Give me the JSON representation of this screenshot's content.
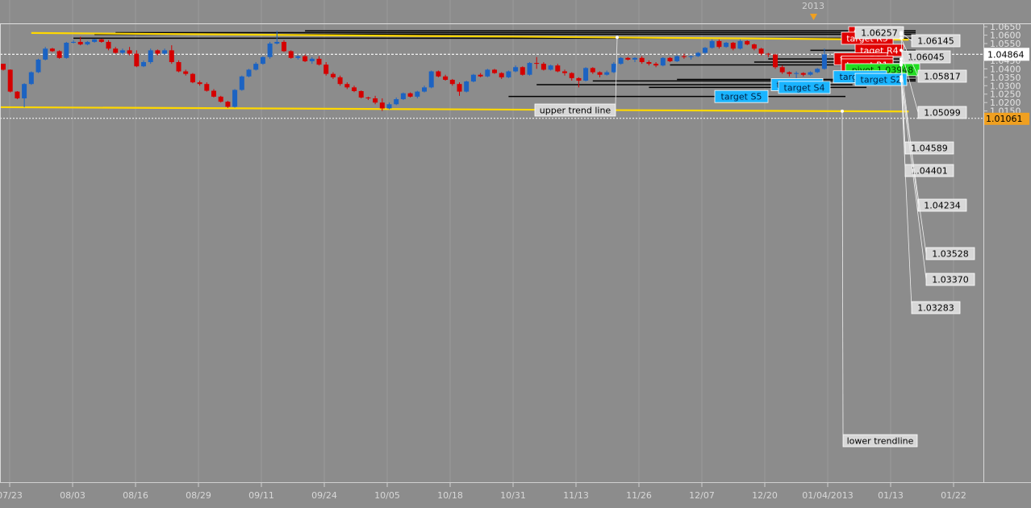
{
  "chart_data": {
    "type": "candlestick",
    "title": "",
    "xlabel": "",
    "ylabel": "",
    "ylim": [
      1.0106,
      1.0665
    ],
    "x_ticks": [
      "07/23",
      "08/03",
      "08/16",
      "08/29",
      "09/11",
      "09/24",
      "10/05",
      "10/18",
      "10/31",
      "11/13",
      "11/26",
      "12/07",
      "12/20",
      "01/04/2013",
      "01/13",
      "01/22"
    ],
    "y_ticks": [
      "1.0650",
      "1.0600",
      "1.0550",
      "1.0500",
      "1.0450",
      "1.0400",
      "1.0350",
      "1.0300",
      "1.0250",
      "1.0200",
      "1.0150"
    ],
    "year_marker": "2013",
    "current_price": "1.04864",
    "bottom_price": "1.01061",
    "colors": {
      "up": "#1c63c2",
      "down": "#d40000",
      "background": "#8c8c8c",
      "trendline": "#ffd800"
    },
    "candles": [
      [
        1.043,
        1.043,
        1.039,
        1.0395
      ],
      [
        1.0395,
        1.0397,
        1.026,
        1.0265
      ],
      [
        1.0265,
        1.0268,
        1.022,
        1.0225
      ],
      [
        1.0225,
        1.0315,
        1.0172,
        1.031
      ],
      [
        1.031,
        1.0385,
        1.0305,
        1.038
      ],
      [
        1.038,
        1.046,
        1.0375,
        1.0455
      ],
      [
        1.0455,
        1.053,
        1.045,
        1.052
      ],
      [
        1.052,
        1.0525,
        1.05,
        1.0505
      ],
      [
        1.0505,
        1.051,
        1.046,
        1.0465
      ],
      [
        1.0465,
        1.056,
        1.046,
        1.0555
      ],
      [
        1.0555,
        1.057,
        1.055,
        1.056
      ],
      [
        1.056,
        1.059,
        1.054,
        1.0545
      ],
      [
        1.0545,
        1.0565,
        1.054,
        1.056
      ],
      [
        1.056,
        1.0578,
        1.0555,
        1.0575
      ],
      [
        1.0575,
        1.0578,
        1.0555,
        1.056
      ],
      [
        1.056,
        1.057,
        1.051,
        1.052
      ],
      [
        1.052,
        1.053,
        1.049,
        1.0495
      ],
      [
        1.0495,
        1.052,
        1.0485,
        1.051
      ],
      [
        1.051,
        1.053,
        1.048,
        1.049
      ],
      [
        1.049,
        1.051,
        1.041,
        1.0415
      ],
      [
        1.0415,
        1.045,
        1.041,
        1.044
      ],
      [
        1.044,
        1.052,
        1.043,
        1.051
      ],
      [
        1.051,
        1.0515,
        1.048,
        1.049
      ],
      [
        1.049,
        1.052,
        1.0485,
        1.051
      ],
      [
        1.051,
        1.054,
        1.043,
        1.044
      ],
      [
        1.044,
        1.045,
        1.038,
        1.0385
      ],
      [
        1.0385,
        1.0395,
        1.036,
        1.037
      ],
      [
        1.037,
        1.0375,
        1.0315,
        1.032
      ],
      [
        1.032,
        1.033,
        1.03,
        1.031
      ],
      [
        1.031,
        1.032,
        1.0265,
        1.027
      ],
      [
        1.027,
        1.028,
        1.023,
        1.0235
      ],
      [
        1.0235,
        1.024,
        1.02,
        1.0205
      ],
      [
        1.0205,
        1.021,
        1.0168,
        1.0175
      ],
      [
        1.0175,
        1.028,
        1.017,
        1.0275
      ],
      [
        1.0275,
        1.036,
        1.027,
        1.0355
      ],
      [
        1.0355,
        1.04,
        1.035,
        1.0395
      ],
      [
        1.0395,
        1.044,
        1.039,
        1.043
      ],
      [
        1.043,
        1.0475,
        1.0425,
        1.047
      ],
      [
        1.047,
        1.056,
        1.046,
        1.055
      ],
      [
        1.055,
        1.0625,
        1.0545,
        1.056
      ],
      [
        1.056,
        1.057,
        1.05,
        1.0505
      ],
      [
        1.0505,
        1.051,
        1.046,
        1.0465
      ],
      [
        1.0465,
        1.048,
        1.0455,
        1.0475
      ],
      [
        1.0475,
        1.0485,
        1.044,
        1.0445
      ],
      [
        1.0445,
        1.047,
        1.043,
        1.046
      ],
      [
        1.046,
        1.0475,
        1.042,
        1.0425
      ],
      [
        1.0425,
        1.044,
        1.036,
        1.037
      ],
      [
        1.037,
        1.038,
        1.034,
        1.035
      ],
      [
        1.035,
        1.036,
        1.03,
        1.031
      ],
      [
        1.031,
        1.032,
        1.028,
        1.029
      ],
      [
        1.029,
        1.03,
        1.0262,
        1.0268
      ],
      [
        1.0268,
        1.0272,
        1.0225,
        1.023
      ],
      [
        1.023,
        1.0235,
        1.0215,
        1.0225
      ],
      [
        1.0225,
        1.024,
        1.019,
        1.02
      ],
      [
        1.02,
        1.0225,
        1.015,
        1.0165
      ],
      [
        1.0165,
        1.02,
        1.016,
        1.019
      ],
      [
        1.019,
        1.023,
        1.0185,
        1.022
      ],
      [
        1.022,
        1.026,
        1.0215,
        1.0255
      ],
      [
        1.0255,
        1.026,
        1.023,
        1.0235
      ],
      [
        1.0235,
        1.027,
        1.0225,
        1.0265
      ],
      [
        1.0265,
        1.03,
        1.026,
        1.029
      ],
      [
        1.029,
        1.039,
        1.0285,
        1.0385
      ],
      [
        1.0385,
        1.039,
        1.035,
        1.0355
      ],
      [
        1.0355,
        1.0365,
        1.033,
        1.0335
      ],
      [
        1.0335,
        1.034,
        1.03,
        1.031
      ],
      [
        1.031,
        1.032,
        1.024,
        1.0265
      ],
      [
        1.0265,
        1.033,
        1.026,
        1.0325
      ],
      [
        1.0325,
        1.037,
        1.032,
        1.0365
      ],
      [
        1.0365,
        1.0375,
        1.035,
        1.0355
      ],
      [
        1.0355,
        1.04,
        1.035,
        1.0395
      ],
      [
        1.0395,
        1.04,
        1.037,
        1.0375
      ],
      [
        1.0375,
        1.038,
        1.034,
        1.035
      ],
      [
        1.035,
        1.039,
        1.0345,
        1.0385
      ],
      [
        1.0385,
        1.042,
        1.038,
        1.041
      ],
      [
        1.041,
        1.0415,
        1.036,
        1.0365
      ],
      [
        1.0365,
        1.044,
        1.036,
        1.0435
      ],
      [
        1.0435,
        1.047,
        1.04,
        1.043
      ],
      [
        1.043,
        1.044,
        1.039,
        1.0395
      ],
      [
        1.0395,
        1.0425,
        1.039,
        1.042
      ],
      [
        1.042,
        1.043,
        1.038,
        1.0385
      ],
      [
        1.0385,
        1.0395,
        1.036,
        1.0375
      ],
      [
        1.0375,
        1.038,
        1.033,
        1.0345
      ],
      [
        1.0345,
        1.035,
        1.029,
        1.033
      ],
      [
        1.033,
        1.041,
        1.0325,
        1.0405
      ],
      [
        1.0405,
        1.041,
        1.037,
        1.038
      ],
      [
        1.038,
        1.0385,
        1.035,
        1.0365
      ],
      [
        1.0365,
        1.039,
        1.036,
        1.038
      ],
      [
        1.038,
        1.044,
        1.0375,
        1.043
      ],
      [
        1.043,
        1.047,
        1.0425,
        1.0465
      ],
      [
        1.0465,
        1.047,
        1.045,
        1.0455
      ],
      [
        1.0455,
        1.047,
        1.044,
        1.0465
      ],
      [
        1.0465,
        1.0475,
        1.043,
        1.044
      ],
      [
        1.044,
        1.045,
        1.042,
        1.043
      ],
      [
        1.043,
        1.044,
        1.041,
        1.042
      ],
      [
        1.042,
        1.047,
        1.0415,
        1.0465
      ],
      [
        1.0465,
        1.047,
        1.044,
        1.0445
      ],
      [
        1.0445,
        1.048,
        1.044,
        1.0475
      ],
      [
        1.0475,
        1.049,
        1.046,
        1.047
      ],
      [
        1.047,
        1.048,
        1.0455,
        1.0475
      ],
      [
        1.0475,
        1.05,
        1.047,
        1.0495
      ],
      [
        1.0495,
        1.053,
        1.049,
        1.0525
      ],
      [
        1.0525,
        1.0575,
        1.052,
        1.0565
      ],
      [
        1.0565,
        1.0575,
        1.052,
        1.053
      ],
      [
        1.053,
        1.056,
        1.0525,
        1.0555
      ],
      [
        1.0555,
        1.056,
        1.051,
        1.052
      ],
      [
        1.052,
        1.0575,
        1.0515,
        1.0565
      ],
      [
        1.0565,
        1.057,
        1.054,
        1.0545
      ],
      [
        1.0545,
        1.055,
        1.051,
        1.052
      ],
      [
        1.052,
        1.0525,
        1.048,
        1.049
      ],
      [
        1.049,
        1.0495,
        1.047,
        1.0485
      ],
      [
        1.0485,
        1.049,
        1.04,
        1.041
      ],
      [
        1.041,
        1.042,
        1.037,
        1.038
      ],
      [
        1.038,
        1.0385,
        1.0355,
        1.037
      ],
      [
        1.037,
        1.0385,
        1.0345,
        1.0375
      ],
      [
        1.0375,
        1.038,
        1.0355,
        1.0365
      ],
      [
        1.0365,
        1.0385,
        1.036,
        1.038
      ],
      [
        1.038,
        1.0405,
        1.0375,
        1.04
      ],
      [
        1.04,
        1.052,
        1.0395,
        1.0486
      ]
    ],
    "upper_trendline": {
      "label": "upper trend line",
      "from": [
        4,
        1.0613
      ],
      "to": [
        129,
        1.0573
      ]
    },
    "lower_trendline": {
      "label": "lower trendline",
      "from": [
        -3,
        1.0173
      ],
      "to": [
        129,
        1.0147
      ]
    },
    "levels": [
      {
        "value": 1.06257,
        "from": 43,
        "to": 130,
        "price_label": "1.06257"
      },
      {
        "value": 1.06145,
        "from": 16,
        "to": 130,
        "price_label": "1.06145",
        "target": "target R6",
        "style": "red"
      },
      {
        "value": 1.06045,
        "from": 13,
        "to": 130,
        "price_label": "1.06045"
      },
      {
        "value": 1.05817,
        "from": 10,
        "to": 130,
        "price_label": "1.05817",
        "target": "target R5",
        "style": "red"
      },
      {
        "value": 1.05099,
        "from": 115,
        "to": 130,
        "price_label": "1.05099",
        "target": "taget R4",
        "style": "red"
      },
      {
        "value": 1.04589,
        "from": 109,
        "to": 130,
        "price_label": "1.04589",
        "target": "target R3",
        "style": "red"
      },
      {
        "value": 1.04401,
        "from": 107,
        "to": 130,
        "price_label": "1.04401",
        "target": "target R2",
        "style": "red"
      },
      {
        "value": 1.04234,
        "from": 95,
        "to": 130,
        "price_label": "1.04234",
        "target": "target R1",
        "style": "red"
      },
      {
        "value": 1.03948,
        "from": 126,
        "to": 130,
        "target": "pivot 1.03948",
        "style": "green"
      },
      {
        "value": 1.03528,
        "from": 124,
        "to": 130,
        "price_label": "1.03528",
        "target": "target S1",
        "style": "cyan"
      },
      {
        "value": 1.0337,
        "from": 96,
        "to": 130,
        "price_label": "1.03370",
        "target": "target S2",
        "style": "cyan"
      },
      {
        "value": 1.03283,
        "from": 84,
        "to": 130,
        "price_label": "1.03283"
      },
      {
        "value": 1.03063,
        "from": 76,
        "to": 121,
        "target": "target S3",
        "style": "cyan"
      },
      {
        "value": 1.029,
        "from": 92,
        "to": 123,
        "target": "target S4",
        "style": "cyan"
      },
      {
        "value": 1.0236,
        "from": 72,
        "to": 120,
        "target": "target S5",
        "style": "cyan"
      }
    ]
  }
}
